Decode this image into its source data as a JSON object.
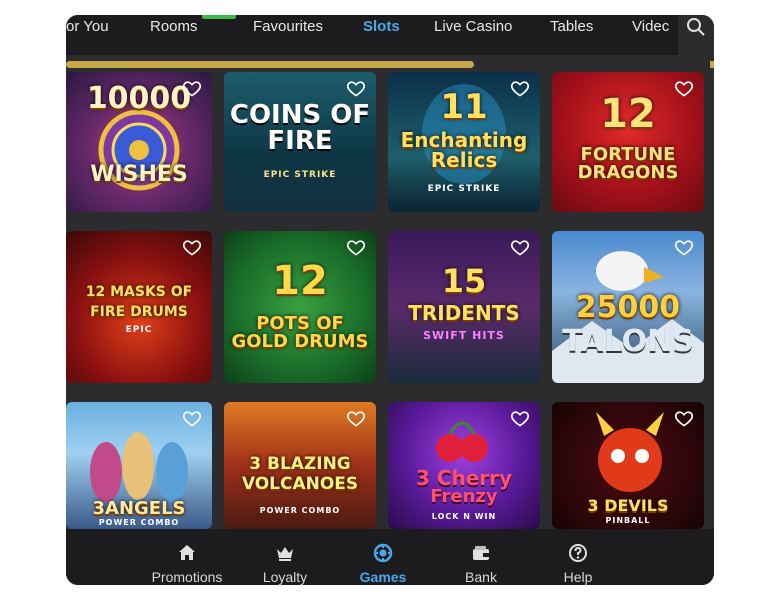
{
  "top_tabs": [
    {
      "label": "or You"
    },
    {
      "label": "Rooms"
    },
    {
      "label": "Favourites"
    },
    {
      "label": "Slots",
      "active": true
    },
    {
      "label": "Live Casino"
    },
    {
      "label": "Tables"
    },
    {
      "label": "Videc"
    }
  ],
  "search": {
    "icon": "search-icon"
  },
  "games": [
    {
      "title": "10000",
      "subtitle": "WISHES"
    },
    {
      "title": "COINS OF FIRE",
      "badge": "EPIC STRIKE"
    },
    {
      "title": "11",
      "subtitle": "Enchanting Relics",
      "badge": "EPIC STRIKE"
    },
    {
      "title": "12",
      "subtitle": "FORTUNE DRAGONS"
    },
    {
      "title": "12 MASKS OF",
      "subtitle": "FIRE DRUMS",
      "badge": "EPIC"
    },
    {
      "title": "12",
      "subtitle": "POTS OF GOLD DRUMS"
    },
    {
      "title": "15",
      "subtitle": "TRIDENTS",
      "badge": "SWIFT HITS"
    },
    {
      "title": "25000",
      "subtitle": "TALONS"
    },
    {
      "title": "3ANGELS",
      "badge": "POWER COMBO"
    },
    {
      "title": "3 BLAZING",
      "subtitle": "VOLCANOES",
      "badge": "POWER COMBO"
    },
    {
      "title": "3 Cherry",
      "subtitle": "Frenzy",
      "badge": "LOCK N WIN"
    },
    {
      "title": "3 DEVILS",
      "badge": "PINBALL"
    }
  ],
  "bottom_nav": [
    {
      "label": "Promotions",
      "icon": "home-icon"
    },
    {
      "label": "Loyalty",
      "icon": "crown-icon"
    },
    {
      "label": "Games",
      "icon": "chip-icon",
      "active": true
    },
    {
      "label": "Bank",
      "icon": "wallet-icon"
    },
    {
      "label": "Help",
      "icon": "help-icon"
    }
  ],
  "colors": {
    "accent": "#4aa8ea",
    "progress": "#c6a74a",
    "nav_background": "#1c1c1e",
    "content_background": "#2c2c2e"
  }
}
